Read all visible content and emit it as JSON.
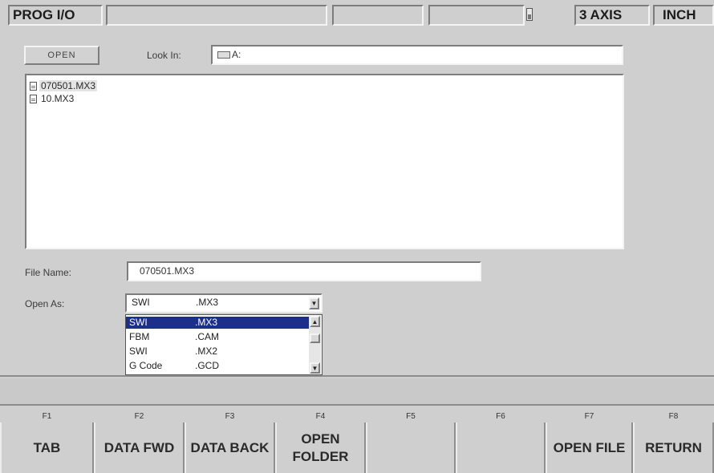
{
  "status_bar": {
    "mode": "PROG I/O",
    "fields": [
      "",
      "",
      ""
    ],
    "axis": "3 AXIS",
    "units": "INCH"
  },
  "dialog": {
    "open_button": "OPEN",
    "look_in_label": "Look In:",
    "look_in_value": "A:",
    "files": [
      "070501.MX3",
      "10.MX3"
    ],
    "file_name_label": "File Name:",
    "file_name_value": "070501.MX3",
    "open_as_label": "Open As:",
    "open_as_selected": {
      "name": "SWI",
      "ext": ".MX3"
    },
    "open_as_options": [
      {
        "name": "SWI",
        "ext": ".MX3"
      },
      {
        "name": "FBM",
        "ext": ".CAM"
      },
      {
        "name": "SWI",
        "ext": ".MX2"
      },
      {
        "name": "G Code",
        "ext": ".GCD"
      }
    ]
  },
  "message_bar": "",
  "function_keys": [
    {
      "key": "F1",
      "label": "TAB"
    },
    {
      "key": "F2",
      "label": "DATA FWD"
    },
    {
      "key": "F3",
      "label": "DATA BACK"
    },
    {
      "key": "F4",
      "label": "OPEN FOLDER"
    },
    {
      "key": "F5",
      "label": ""
    },
    {
      "key": "F6",
      "label": ""
    },
    {
      "key": "F7",
      "label": "OPEN FILE"
    },
    {
      "key": "F8",
      "label": "RETURN"
    }
  ],
  "colors": {
    "background": "#cfcfcf",
    "selection": "#1c2f8a",
    "field": "#ffffff"
  }
}
